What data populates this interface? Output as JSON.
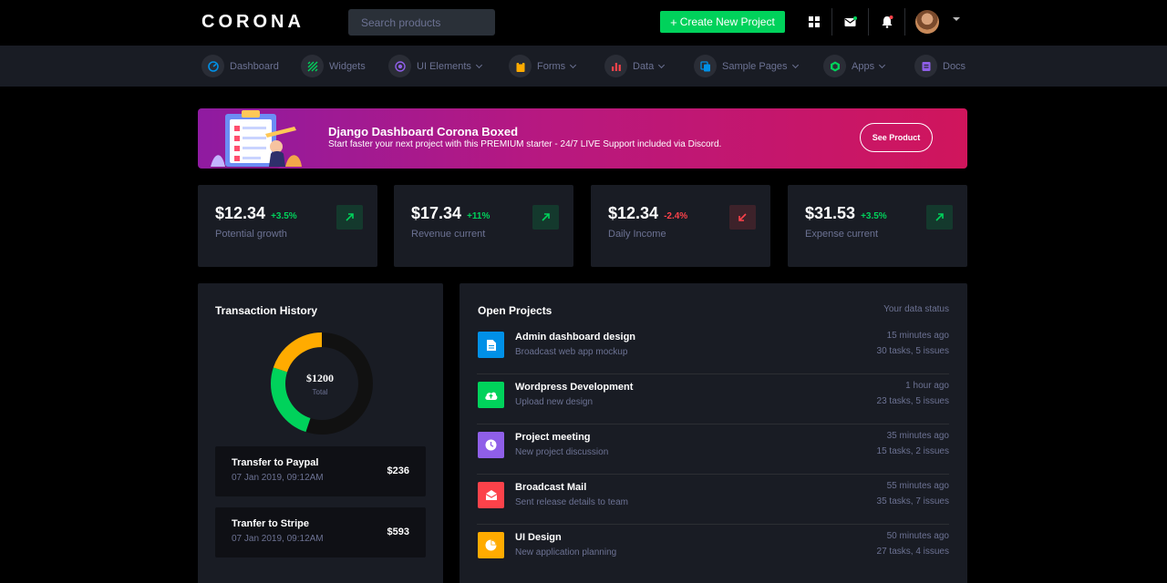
{
  "header": {
    "brand": "CORONA",
    "search_placeholder": "Search products",
    "create_button": "Create New Project",
    "create_button_plus": "+"
  },
  "nav": {
    "items": [
      {
        "label": "Dashboard",
        "icon": "speedometer-icon",
        "color": "#0090e7",
        "has_caret": false
      },
      {
        "label": "Widgets",
        "icon": "stripes-icon",
        "color": "#00d25b",
        "has_caret": false
      },
      {
        "label": "UI Elements",
        "icon": "target-icon",
        "color": "#8f5fe8",
        "has_caret": true
      },
      {
        "label": "Forms",
        "icon": "clipboard-icon",
        "color": "#ffab00",
        "has_caret": true
      },
      {
        "label": "Data",
        "icon": "bar-chart-icon",
        "color": "#fc424a",
        "has_caret": true
      },
      {
        "label": "Sample Pages",
        "icon": "copy-icon",
        "color": "#0090e7",
        "has_caret": true
      },
      {
        "label": "Apps",
        "icon": "hexagon-icon",
        "color": "#00d25b",
        "has_caret": true
      },
      {
        "label": "Docs",
        "icon": "document-icon",
        "color": "#8f5fe8",
        "has_caret": false
      }
    ]
  },
  "banner": {
    "title": "Django Dashboard Corona Boxed",
    "subtitle": "Start faster your next project with this PREMIUM starter - 24/7 LIVE Support included via Discord.",
    "button": "See Product"
  },
  "stats": [
    {
      "value": "$12.34",
      "change": "+3.5%",
      "trend": "up",
      "label": "Potential growth"
    },
    {
      "value": "$17.34",
      "change": "+11%",
      "trend": "up",
      "label": "Revenue current"
    },
    {
      "value": "$12.34",
      "change": "-2.4%",
      "trend": "down",
      "label": "Daily Income"
    },
    {
      "value": "$31.53",
      "change": "+3.5%",
      "trend": "up",
      "label": "Expense current"
    }
  ],
  "transactions": {
    "title": "Transaction History",
    "donut": {
      "total": "$1200",
      "total_label": "Total",
      "segments": [
        {
          "fraction": 0.55,
          "color": "#111111"
        },
        {
          "fraction": 0.25,
          "color": "#00d25b"
        },
        {
          "fraction": 0.2,
          "color": "#ffab00"
        }
      ]
    },
    "items": [
      {
        "name": "Transfer to Paypal",
        "date": "07 Jan 2019, 09:12AM",
        "amount": "$236"
      },
      {
        "name": "Tranfer to Stripe",
        "date": "07 Jan 2019, 09:12AM",
        "amount": "$593"
      }
    ]
  },
  "projects": {
    "title": "Open Projects",
    "status_label": "Your data status",
    "items": [
      {
        "name": "Admin dashboard design",
        "desc": "Broadcast web app mockup",
        "time": "15 minutes ago",
        "tasks": "30 tasks, 5 issues",
        "icon": "file-icon",
        "color": "#0090e7"
      },
      {
        "name": "Wordpress Development",
        "desc": "Upload new design",
        "time": "1 hour ago",
        "tasks": "23 tasks, 5 issues",
        "icon": "cloud-upload-icon",
        "color": "#00d25b"
      },
      {
        "name": "Project meeting",
        "desc": "New project discussion",
        "time": "35 minutes ago",
        "tasks": "15 tasks, 2 issues",
        "icon": "clock-icon",
        "color": "#8f5fe8"
      },
      {
        "name": "Broadcast Mail",
        "desc": "Sent release details to team",
        "time": "55 minutes ago",
        "tasks": "35 tasks, 7 issues",
        "icon": "mail-open-icon",
        "color": "#fc424a"
      },
      {
        "name": "UI Design",
        "desc": "New application planning",
        "time": "50 minutes ago",
        "tasks": "27 tasks, 4 issues",
        "icon": "pie-chart-icon",
        "color": "#ffab00"
      }
    ]
  }
}
